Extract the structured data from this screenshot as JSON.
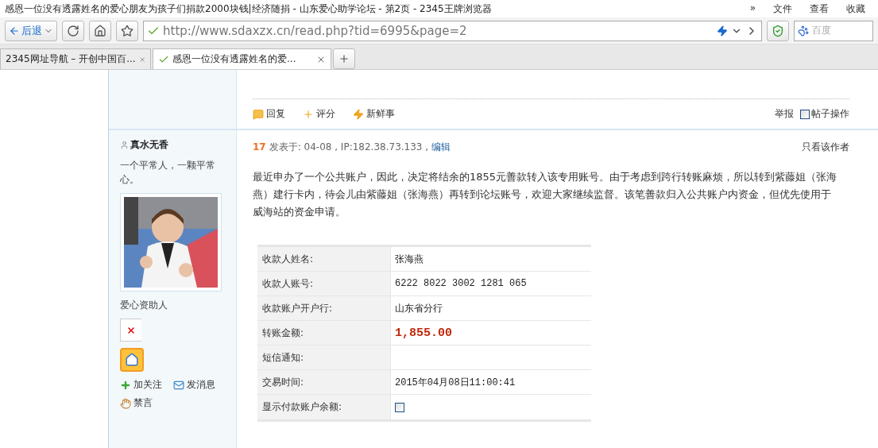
{
  "window": {
    "title": "感恩一位没有透露姓名的爱心朋友为孩子们捐款2000块钱|经济随捐 - 山东爱心助学论坛 - 第2页 - 2345王牌浏览器",
    "menu": [
      "»",
      "文件",
      "查看",
      "收藏"
    ]
  },
  "toolbar": {
    "back": "后退",
    "url": "http://www.sdaxzx.cn/read.php?tid=6995&page=2",
    "search_placeholder": "百度"
  },
  "tabs": [
    {
      "label": "2345网址导航 – 开创中国百...",
      "selected": false
    },
    {
      "label": "感恩一位没有透露姓名的爱...",
      "selected": true
    }
  ],
  "prev_post_actions": {
    "items": [
      "回复",
      "评分",
      "新鲜事"
    ],
    "report": "举报",
    "manage": {
      "label": "帖子操作",
      "checked": false
    }
  },
  "post": {
    "author": "真水无香",
    "signature": "一个平常人，一颗平常心。",
    "avatar": {
      "kind": "picture"
    },
    "rank": "爱心资助人",
    "links": [
      "加关注",
      "发消息",
      "禁言"
    ],
    "floor": "17",
    "meta": "发表于: 04-08 , IP:182.38.73.133 ,",
    "edit": "编辑",
    "only_author": "只看该作者",
    "body": "最近申办了一个公共账户，因此，决定将结余的1855元善款转入该专用账号。由于考虑到跨行转账麻烦，所以转到紫藤姐（张海燕）建行卡内，待会儿由紫藤姐（张海燕）再转到论坛账号，欢迎大家继续监督。该笔善款归入公共账户内资金，但优先使用于威海站的资金申请。",
    "receipt": [
      {
        "label": "收款人姓名:",
        "kind": "text",
        "value": "张海燕"
      },
      {
        "label": "收款人账号:",
        "kind": "mono",
        "value": "6222 8022 3002 1281 065"
      },
      {
        "label": "收款账户开户行:",
        "kind": "text",
        "value": "山东省分行"
      },
      {
        "label": "转账金额:",
        "kind": "amount",
        "value": "1,855.00"
      },
      {
        "label": "短信通知:",
        "kind": "empty"
      },
      {
        "label": "交易时间:",
        "kind": "mono",
        "value": "2015年04月08日11:00:41"
      },
      {
        "label": "显示付款账户余额:",
        "kind": "checkbox",
        "checked": false
      }
    ]
  }
}
